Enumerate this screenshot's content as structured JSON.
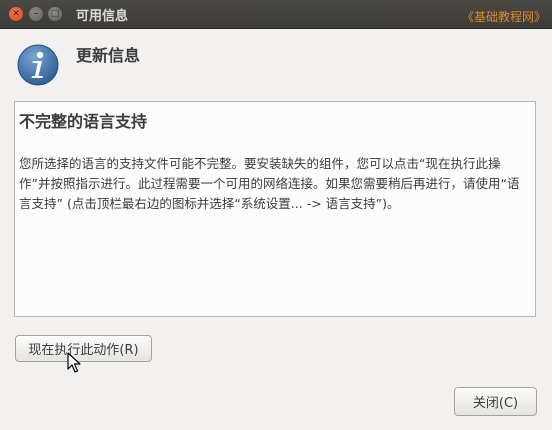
{
  "window": {
    "title": "可用信息",
    "watermark": "《基础教程网》",
    "controls": [
      "close-icon",
      "minimize-icon",
      "maximize-icon"
    ]
  },
  "header": {
    "title": "更新信息",
    "icon": "info-icon"
  },
  "panel": {
    "heading": "不完整的语言支持",
    "body": "您所选择的语言的支持文件可能不完整。要安装缺失的组件，您可以点击“现在执行此操作”并按照指示进行。此过程需要一个可用的网络连接。如果您需要稍后再进行，请使用“语言支持” (点击顶栏最右边的图标并选择“系统设置... -> 语言支持”)。"
  },
  "buttons": {
    "action_label": "现在执行此动作(R)",
    "close_label": "关闭(C)"
  },
  "colors": {
    "titlebar": "#3c3b37",
    "close_button": "#e0501e",
    "info_icon": "#3a6fa5",
    "watermark": "#e08a2c"
  }
}
